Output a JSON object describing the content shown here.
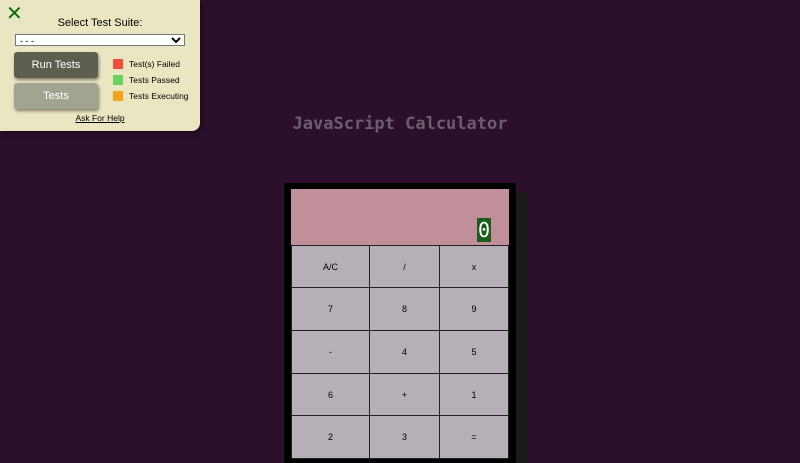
{
  "test_panel": {
    "close_glyph": "✕",
    "title": "Select Test Suite:",
    "selected_suite": "- - -",
    "run_tests_label": "Run Tests",
    "tests_label": "Tests",
    "legend": [
      {
        "label": "Test(s) Failed",
        "color": "#f04e3a"
      },
      {
        "label": "Tests Passed",
        "color": "#6bd35c"
      },
      {
        "label": "Tests Executing",
        "color": "#f5a21c"
      }
    ],
    "help_label": "Ask For Help"
  },
  "page": {
    "title": "JavaScript Calculator"
  },
  "calculator": {
    "display_value": "0",
    "keys": [
      "A/C",
      "/",
      "x",
      "7",
      "8",
      "9",
      "-",
      "4",
      "5",
      "6",
      "+",
      "1",
      "2",
      "3",
      "="
    ]
  }
}
